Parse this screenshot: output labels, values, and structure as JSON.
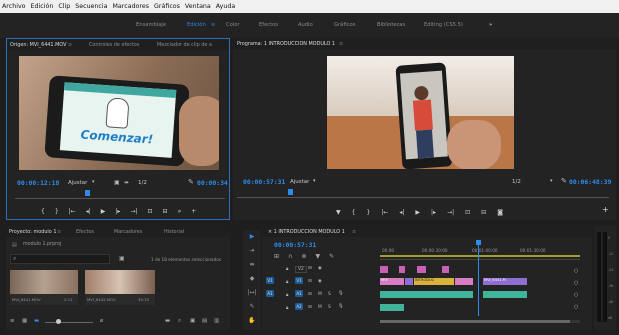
{
  "menu": [
    "Archivo",
    "Edición",
    "Clip",
    "Secuencia",
    "Marcadores",
    "Gráficos",
    "Ventana",
    "Ayuda"
  ],
  "workspaces": [
    "Ensamblaje",
    "Edición",
    "≡",
    "Color",
    "Efectos",
    "Audio",
    "Gráficos",
    "Bibliotecas",
    "Editing (CS5.5)",
    "»"
  ],
  "source": {
    "tabs": [
      "Origen: MVI_6441.MOV",
      "≡",
      "Controles de efectos",
      "Mezclador de clip de a"
    ],
    "timecode_in": "00:00:12:18",
    "fit": "Ajustar",
    "resolution": "1/2",
    "timecode_out": "00:00:34",
    "screen_title": "Comenzar!"
  },
  "program": {
    "tab": "Programa: 1 INTRODUCCION MODULO 1",
    "menu_icon": "≡",
    "timecode_in": "00:00:57:31",
    "fit": "Ajustar",
    "resolution": "1/2",
    "timecode_out": "00:06:48:39"
  },
  "project": {
    "tabs": [
      "Proyecto: modulo 1",
      "≡",
      "Efectos",
      "Marcadores",
      "Historial"
    ],
    "file": "modulo 1.prproj",
    "count": "1 de 18 elementos seleccionados",
    "items": [
      {
        "name": "MVI_6441.MOV",
        "duration": "2:11"
      },
      {
        "name": "MVI_6442.MOV",
        "duration": "35:15"
      }
    ]
  },
  "timeline": {
    "tab": "× 1 INTRODUCCION MODULO 1",
    "menu_icon": "≡",
    "timecode": "00:00:57:31",
    "ruler": [
      "00:00",
      "00:00:30:00",
      "00:01:00:00",
      "00:01:30:00"
    ],
    "tracks": [
      "V2",
      "V1",
      "A1",
      "A2"
    ],
    "clips": [
      "MVI",
      "INTRODUC",
      "MVI_6441.M"
    ]
  },
  "meter": {
    "labels": [
      "0",
      "-12",
      "-24",
      "-36",
      "-48",
      "dB"
    ]
  }
}
